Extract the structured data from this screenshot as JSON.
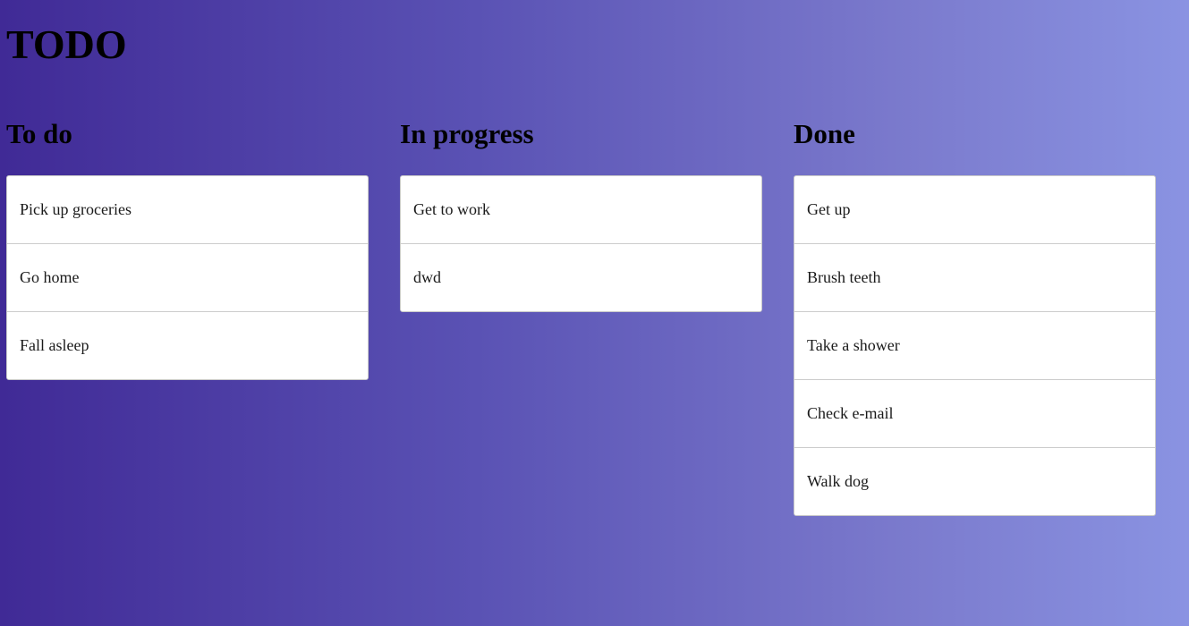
{
  "app": {
    "title": "TODO"
  },
  "columns": [
    {
      "title": "To do",
      "items": [
        "Pick up groceries",
        "Go home",
        "Fall asleep"
      ]
    },
    {
      "title": "In progress",
      "items": [
        "Get to work",
        "dwd"
      ]
    },
    {
      "title": "Done",
      "items": [
        "Get up",
        "Brush teeth",
        "Take a shower",
        "Check e-mail",
        "Walk dog"
      ]
    }
  ],
  "colors": {
    "background_start": "#402a96",
    "background_end": "#8a93e2",
    "card_background": "#ffffff",
    "card_border": "#c9c9c9"
  }
}
